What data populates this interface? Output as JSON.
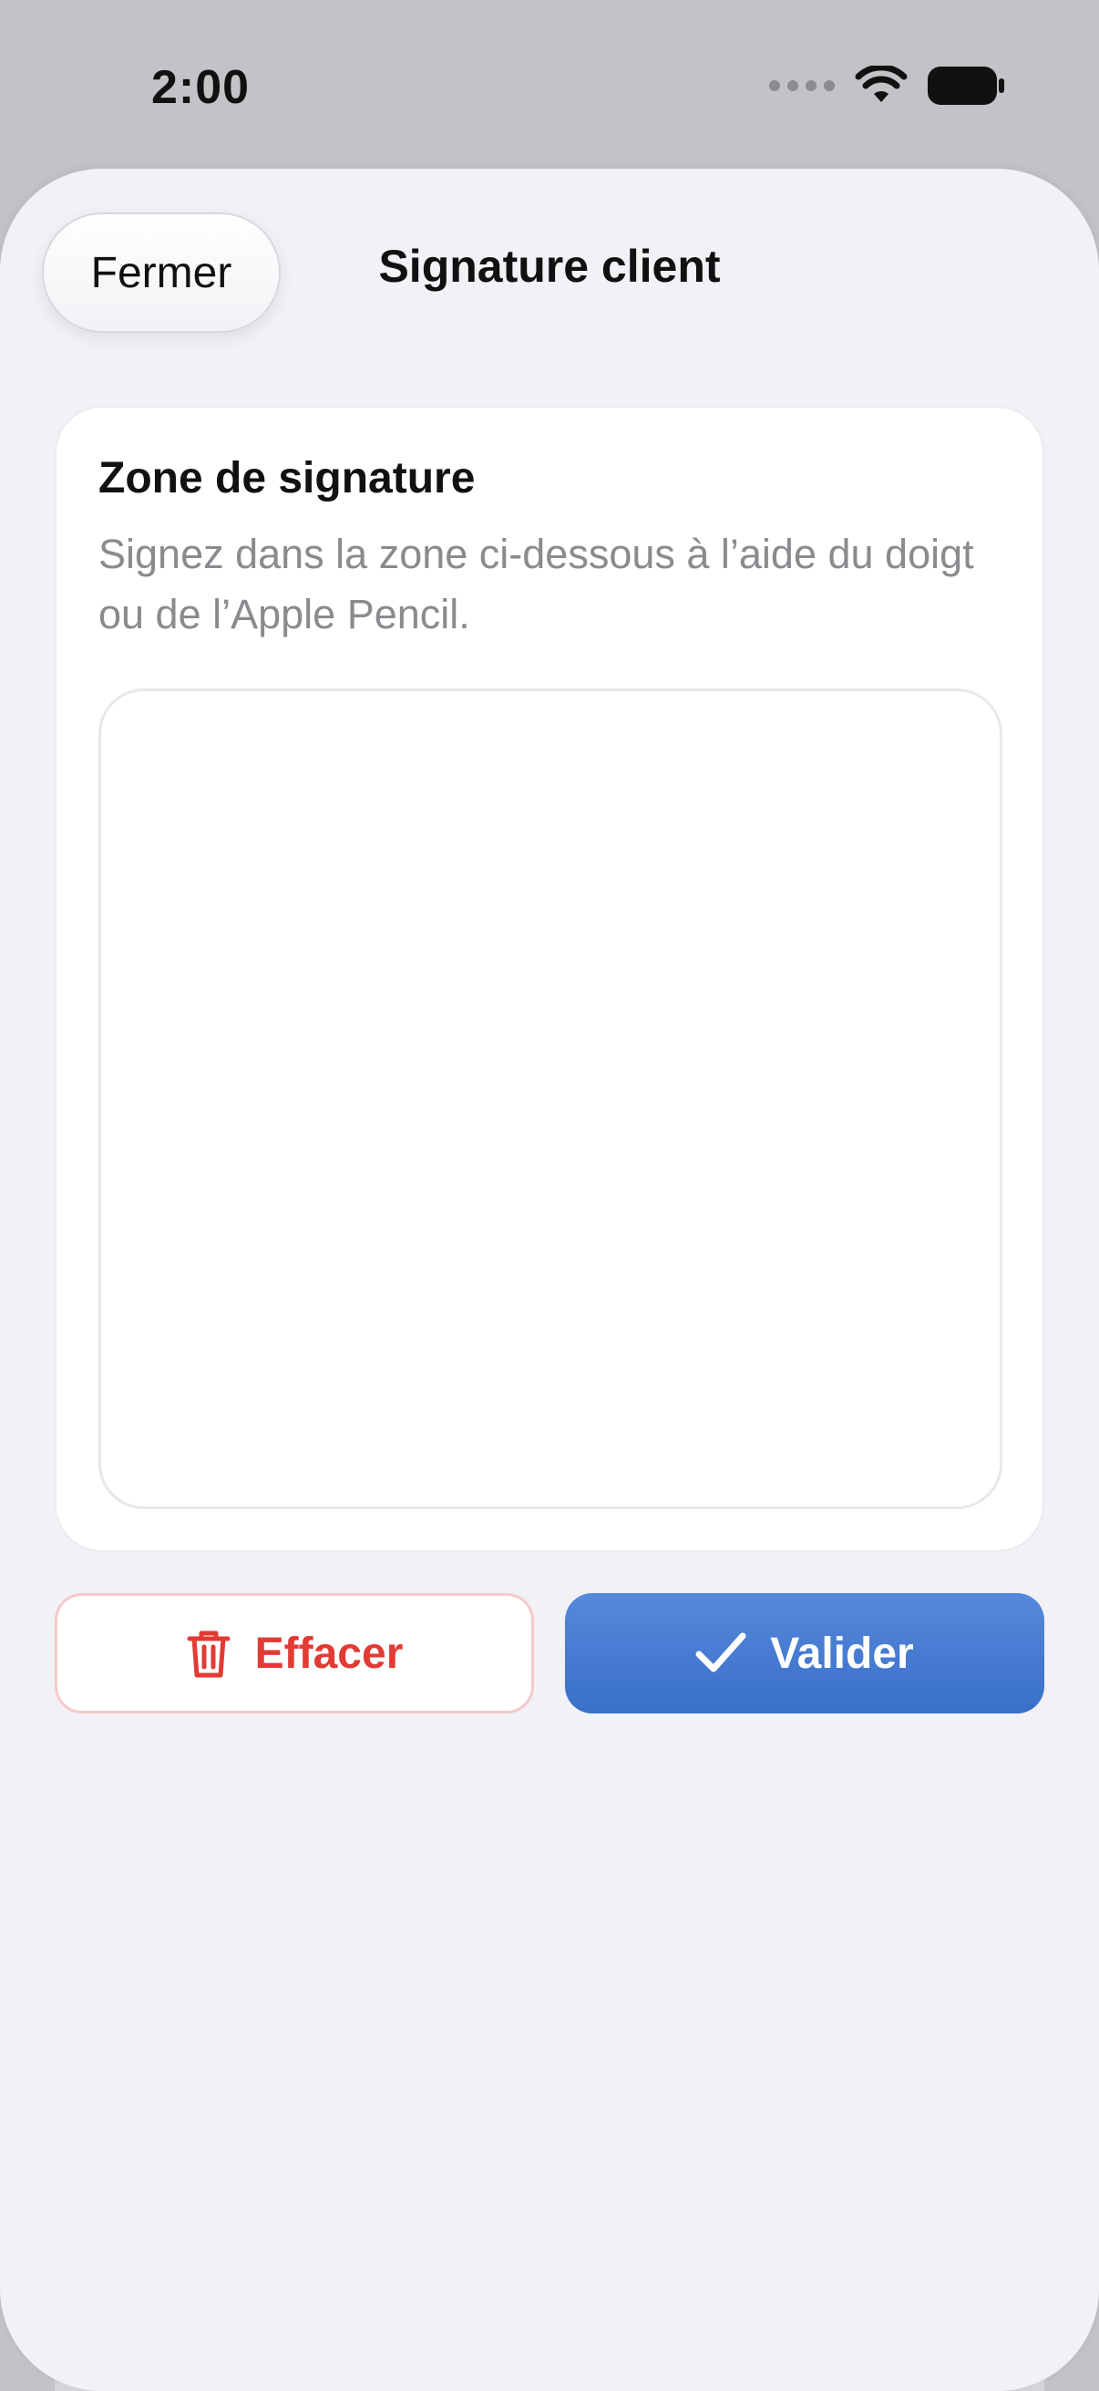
{
  "status_bar": {
    "time": "2:00",
    "icons": [
      "cellular-dots-icon",
      "wifi-icon",
      "battery-icon"
    ]
  },
  "header": {
    "close_label": "Fermer",
    "title": "Signature client"
  },
  "card": {
    "title": "Zone de signature",
    "description": "Signez dans la zone ci-dessous à l’aide du doigt ou de l’Apple Pencil."
  },
  "actions": {
    "clear_label": "Effacer",
    "clear_icon": "trash-icon",
    "validate_label": "Valider",
    "validate_icon": "checkmark-icon"
  },
  "colors": {
    "accent_blue": "#3f74cc",
    "destructive_red": "#e23b34",
    "sheet_background": "#f1f1f6"
  }
}
